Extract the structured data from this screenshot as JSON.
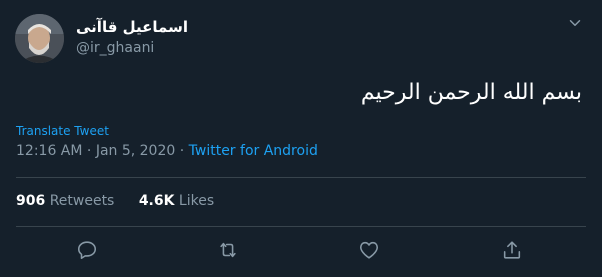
{
  "user": {
    "display_name": "اسماعیل قاآنی",
    "handle": "@ir_ghaani"
  },
  "tweet": {
    "text": "بسم الله الرحمن الرحیم",
    "translate_label": "Translate Tweet",
    "time": "12:16 AM",
    "date": "Jan 5, 2020",
    "separator": " · ",
    "source": "Twitter for Android"
  },
  "stats": {
    "retweets_count": "906",
    "retweets_label": "Retweets",
    "likes_count": "4.6K",
    "likes_label": "Likes"
  },
  "icons": {
    "caret": "chevron-down-icon",
    "reply": "reply-icon",
    "retweet": "retweet-icon",
    "like": "heart-icon",
    "share": "share-icon"
  },
  "colors": {
    "background": "#15202b",
    "link": "#1da1f2",
    "secondary_text": "#8899a6",
    "divider": "#38444d"
  }
}
